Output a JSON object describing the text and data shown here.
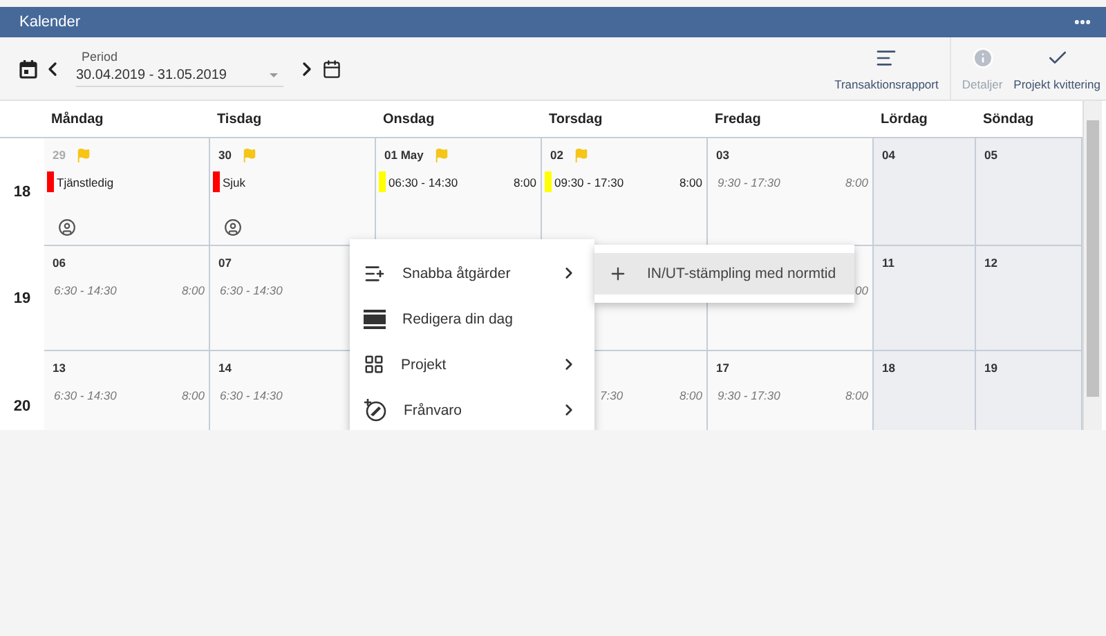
{
  "window": {
    "title": "Kalender"
  },
  "toolbar": {
    "period_label": "Period",
    "period_value": "30.04.2019 - 31.05.2019",
    "actions": [
      {
        "kind": "report",
        "label": "Transaktionsrapport",
        "disabled": false
      },
      {
        "kind": "info",
        "label": "Detaljer",
        "disabled": true
      },
      {
        "kind": "check",
        "label": "Projekt kvittering",
        "disabled": false
      }
    ]
  },
  "days": [
    {
      "label": "Måndag",
      "weekend": false
    },
    {
      "label": "Tisdag",
      "weekend": false
    },
    {
      "label": "Onsdag",
      "weekend": false
    },
    {
      "label": "Torsdag",
      "weekend": false
    },
    {
      "label": "Fredag",
      "weekend": false
    },
    {
      "label": "Lördag",
      "weekend": true
    },
    {
      "label": "Söndag",
      "weekend": true
    }
  ],
  "weeks": [
    {
      "number": "18",
      "cells": [
        {
          "date": "29",
          "muted": true,
          "flag": true,
          "person_icon": true,
          "entry": {
            "kind": "bar",
            "color": "#ff0000",
            "label": "Tjänstledig"
          }
        },
        {
          "date": "30",
          "flag": true,
          "person_icon": true,
          "entry": {
            "kind": "bar",
            "color": "#ff0000",
            "label": "Sjuk"
          }
        },
        {
          "date": "01 May",
          "flag": true,
          "entry": {
            "kind": "bar",
            "color": "#ffff00",
            "time": "06:30 - 14:30",
            "hours": "8:00"
          }
        },
        {
          "date": "02",
          "flag": true,
          "entry": {
            "kind": "bar",
            "color": "#ffff00",
            "time": "09:30 - 17:30",
            "hours": "8:00"
          }
        },
        {
          "date": "03",
          "entry": {
            "kind": "plan",
            "time": "9:30 - 17:30",
            "hours": "8:00"
          }
        },
        {
          "date": "04"
        },
        {
          "date": "05"
        }
      ]
    },
    {
      "number": "19",
      "cells": [
        {
          "date": "06",
          "entry": {
            "kind": "plan",
            "time": "6:30 - 14:30",
            "hours": "8:00"
          }
        },
        {
          "date": "07",
          "entry": {
            "kind": "plan",
            "time": "6:30 - 14:30"
          }
        },
        {},
        {},
        {
          "entry": {
            "kind": "plan",
            "hours": "00"
          }
        },
        {
          "date": "11"
        },
        {
          "date": "12"
        }
      ]
    },
    {
      "number": "20",
      "cells": [
        {
          "date": "13",
          "entry": {
            "kind": "plan",
            "time": "6:30 - 14:30",
            "hours": "8:00"
          }
        },
        {
          "date": "14",
          "entry": {
            "kind": "plan",
            "time": "6:30 - 14:30"
          }
        },
        {},
        {
          "entry": {
            "kind": "plan_tail",
            "time": "7:30",
            "hours": "8:00"
          }
        },
        {
          "date": "17",
          "entry": {
            "kind": "plan",
            "time": "9:30 - 17:30",
            "hours": "8:00"
          }
        },
        {
          "date": "18"
        },
        {
          "date": "19"
        }
      ]
    }
  ],
  "context_menu": {
    "items": [
      {
        "kind": "quick",
        "label": "Snabba åtgärder",
        "submenu": true
      },
      {
        "kind": "edit",
        "label": "Redigera din dag",
        "submenu": false
      },
      {
        "kind": "project",
        "label": "Projekt",
        "submenu": true
      },
      {
        "kind": "absence",
        "label": "Frånvaro",
        "submenu": true
      }
    ]
  },
  "submenu": {
    "items": [
      {
        "label": "IN/UT-stämpling med normtid",
        "selected": true
      }
    ]
  }
}
